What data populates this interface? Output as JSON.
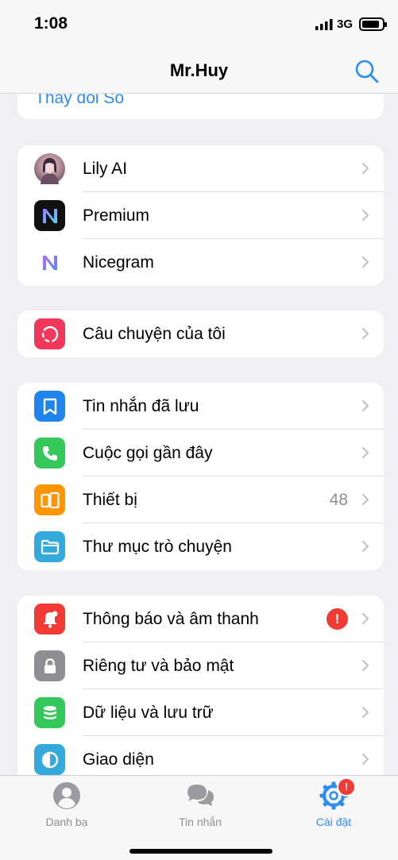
{
  "status_bar": {
    "time": "1:08",
    "network": "3G"
  },
  "nav": {
    "title": "Mr.Huy"
  },
  "top_card": {
    "link_label": "Thay đổi Số"
  },
  "group1": [
    {
      "label": "Lily AI",
      "icon": "avatar"
    },
    {
      "label": "Premium",
      "icon": "premium-logo"
    },
    {
      "label": "Nicegram",
      "icon": "nicegram-logo"
    }
  ],
  "group2": [
    {
      "label": "Câu chuyện của tôi",
      "icon": "stories-icon",
      "color": "#f2385a"
    }
  ],
  "group3": [
    {
      "label": "Tin nhắn đã lưu",
      "icon": "bookmark-icon",
      "color": "#1f84ee"
    },
    {
      "label": "Cuộc gọi gần đây",
      "icon": "phone-icon",
      "color": "#34c759"
    },
    {
      "label": "Thiết bị",
      "icon": "devices-icon",
      "color": "#ff9500",
      "value": "48"
    },
    {
      "label": "Thư mục trò chuyện",
      "icon": "folder-icon",
      "color": "#34aadc"
    }
  ],
  "group4": [
    {
      "label": "Thông báo và âm thanh",
      "icon": "bell-icon",
      "color": "#f23b34",
      "alert": "!"
    },
    {
      "label": "Riêng tư và bảo mật",
      "icon": "lock-icon",
      "color": "#8e8e93"
    },
    {
      "label": "Dữ liệu và lưu trữ",
      "icon": "database-icon",
      "color": "#34c759"
    },
    {
      "label": "Giao diện",
      "icon": "appearance-icon",
      "color": "#34aadc"
    }
  ],
  "tabs": [
    {
      "label": "Danh bạ",
      "icon": "contacts-icon"
    },
    {
      "label": "Tin nhắn",
      "icon": "chats-icon"
    },
    {
      "label": "Cài đặt",
      "icon": "settings-icon",
      "badge": "!"
    }
  ],
  "colors": {
    "accent": "#2d8cf0",
    "background": "#efeff4",
    "alert": "#f23b34"
  }
}
